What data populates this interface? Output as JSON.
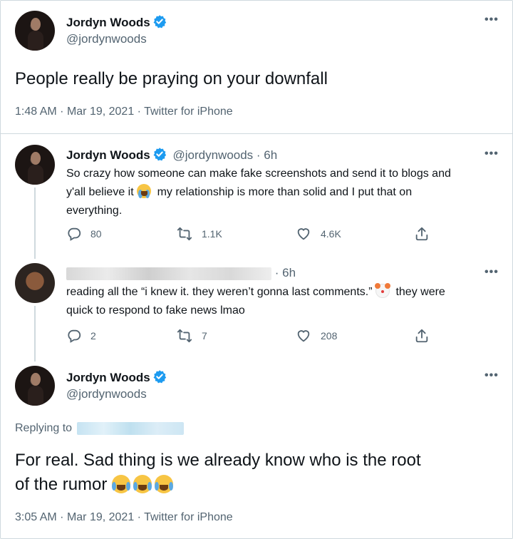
{
  "main_tweet": {
    "name": "Jordyn Woods",
    "handle": "@jordynwoods",
    "text": "People really be praying on your downfall",
    "time": "1:48 AM",
    "date": "Mar 19, 2021",
    "source": "Twitter for iPhone"
  },
  "reply1": {
    "name": "Jordyn Woods",
    "handle": "@jordynwoods",
    "age": "6h",
    "text_line1": "So crazy how someone can make fake screenshots and send it to blogs and",
    "text_line2a": "y'all believe it",
    "text_line2b": "my relationship is more than solid and I put that on",
    "text_line3": "everything.",
    "replies": "80",
    "retweets": "1.1K",
    "likes": "4.6K"
  },
  "reply2": {
    "age": "6h",
    "text_line1a": "reading all the “i knew it. they weren’t gonna last comments.”",
    "text_line1b": "they were",
    "text_line2": "quick to respond to fake news lmao",
    "replies": "2",
    "retweets": "7",
    "likes": "208"
  },
  "final_tweet": {
    "name": "Jordyn Woods",
    "handle": "@jordynwoods",
    "replying_to_label": "Replying to",
    "text_line1": "For real. Sad thing is we already know who is the root",
    "text_line2": "of the rumor",
    "time": "3:05 AM",
    "date": "Mar 19, 2021",
    "source": "Twitter for iPhone"
  },
  "icons": {
    "verified": "verified-badge-icon",
    "more": "more-options-icon",
    "reply": "reply-icon",
    "retweet": "retweet-icon",
    "like": "heart-icon",
    "share": "share-icon"
  },
  "colors": {
    "text": "#0f1419",
    "secondary": "#536471",
    "verified": "#1d9bf0",
    "border": "#cfd9de"
  }
}
